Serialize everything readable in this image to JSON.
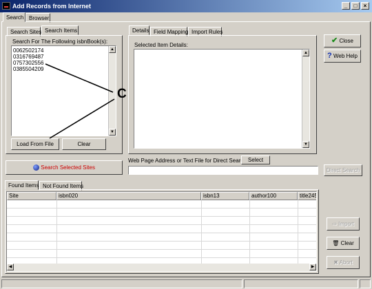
{
  "window": {
    "title": "Add Records from Internet",
    "controls": [
      "_",
      "□",
      "×"
    ]
  },
  "main_tabs": [
    "Search",
    "Browser"
  ],
  "left_panel": {
    "tabs": [
      "Search Sites",
      "Search Items"
    ],
    "list_label": "Search For The Following isbnBook(s):",
    "isbn_items": [
      "0062502174",
      "0316769487",
      "0757302556",
      "0385504209"
    ],
    "load_button": "Load From File",
    "clear_button": "Clear"
  },
  "callout_label": "C",
  "right_panel": {
    "tabs": [
      "Details",
      "Field Mapping",
      "Import Rules"
    ],
    "details_label": "Selected Item Details:"
  },
  "side_buttons": {
    "close": "Close",
    "web_help": "Web Help"
  },
  "search_selected_sites": "Search Selected Sites",
  "direct_search": {
    "label": "Web Page Address or Text File for Direct Search:",
    "select_button": "Select",
    "input_value": "",
    "direct_button": "Direct Search"
  },
  "results": {
    "tabs": [
      "Found Items",
      "Not Found Items"
    ],
    "columns": [
      "Site",
      "isbn020",
      "isbn13",
      "author100",
      "title245"
    ]
  },
  "action_buttons": {
    "import": "Import",
    "clear": "Clear",
    "abort": "Abort"
  },
  "colors": {
    "title_start": "#0a246a",
    "title_end": "#a6caf0",
    "face": "#d4d0c8",
    "callout": "#000000",
    "search_link": "#cc0000"
  }
}
